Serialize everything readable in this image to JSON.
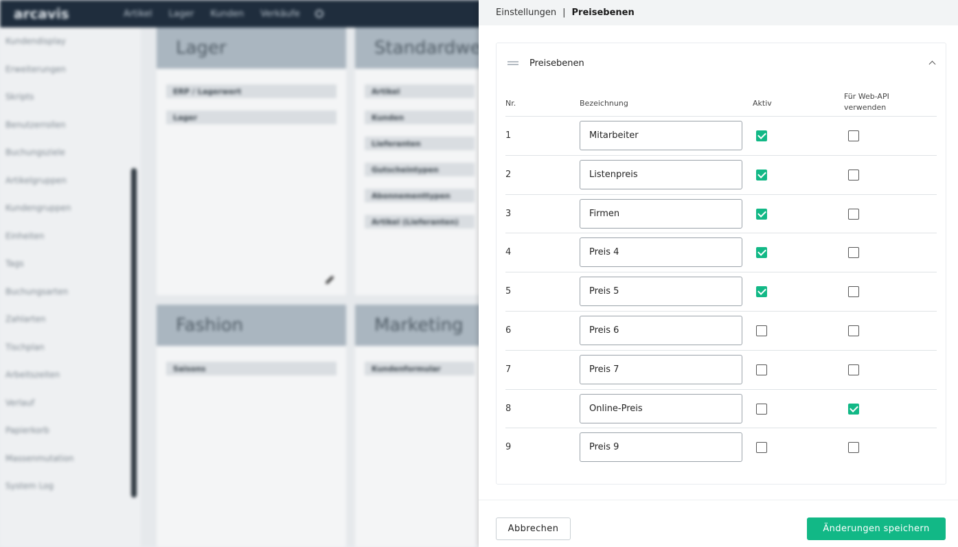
{
  "background": {
    "logo": "arcavis",
    "nav": [
      "Artikel",
      "Lager",
      "Kunden",
      "Verkäufe"
    ],
    "sidebar": [
      "Kundendisplay",
      "Erweiterungen",
      "Skripts",
      "Benutzerrollen",
      "Buchungsziele",
      "Artikelgruppen",
      "Kundengruppen",
      "Einheiten",
      "Tags",
      "Buchungsarten",
      "Zahlarten",
      "Tischplan",
      "Arbeitszeiten",
      "Verlauf",
      "Papierkorb",
      "Massenmutation",
      "System Log"
    ],
    "tiles": [
      {
        "title": "Lager",
        "items": [
          "ERP / Lagerwert",
          "Lager"
        ]
      },
      {
        "title": "Standardwerte",
        "items": [
          "Artikel",
          "Kunden",
          "Lieferanten",
          "Gutscheintypen",
          "Abonnementtypen",
          "Artikel (Lieferanten)"
        ]
      },
      {
        "title": "Fashion",
        "items": [
          "Saisons"
        ]
      },
      {
        "title": "Marketing",
        "items": [
          "Kundenformular"
        ]
      }
    ]
  },
  "breadcrumb": {
    "parent": "Einstellungen",
    "separator": "|",
    "current": "Preisebenen"
  },
  "card": {
    "title": "Preisebenen"
  },
  "table": {
    "headers": {
      "nr": "Nr.",
      "bezeichnung": "Bezeichnung",
      "aktiv": "Aktiv",
      "web_api": "Für Web-API\nverwenden"
    },
    "rows": [
      {
        "nr": "1",
        "name": "Mitarbeiter",
        "aktiv": true,
        "web_api": false
      },
      {
        "nr": "2",
        "name": "Listenpreis",
        "aktiv": true,
        "web_api": false
      },
      {
        "nr": "3",
        "name": "Firmen",
        "aktiv": true,
        "web_api": false
      },
      {
        "nr": "4",
        "name": "Preis 4",
        "aktiv": true,
        "web_api": false
      },
      {
        "nr": "5",
        "name": "Preis 5",
        "aktiv": true,
        "web_api": false
      },
      {
        "nr": "6",
        "name": "Preis 6",
        "aktiv": false,
        "web_api": false
      },
      {
        "nr": "7",
        "name": "Preis 7",
        "aktiv": false,
        "web_api": false
      },
      {
        "nr": "8",
        "name": "Online-Preis",
        "aktiv": false,
        "web_api": true
      },
      {
        "nr": "9",
        "name": "Preis 9",
        "aktiv": false,
        "web_api": false
      }
    ]
  },
  "footer": {
    "cancel_label": "Abbrechen",
    "save_label": "Änderungen speichern"
  },
  "colors": {
    "accent": "#12b886",
    "topbar": "#1f2d3d"
  }
}
